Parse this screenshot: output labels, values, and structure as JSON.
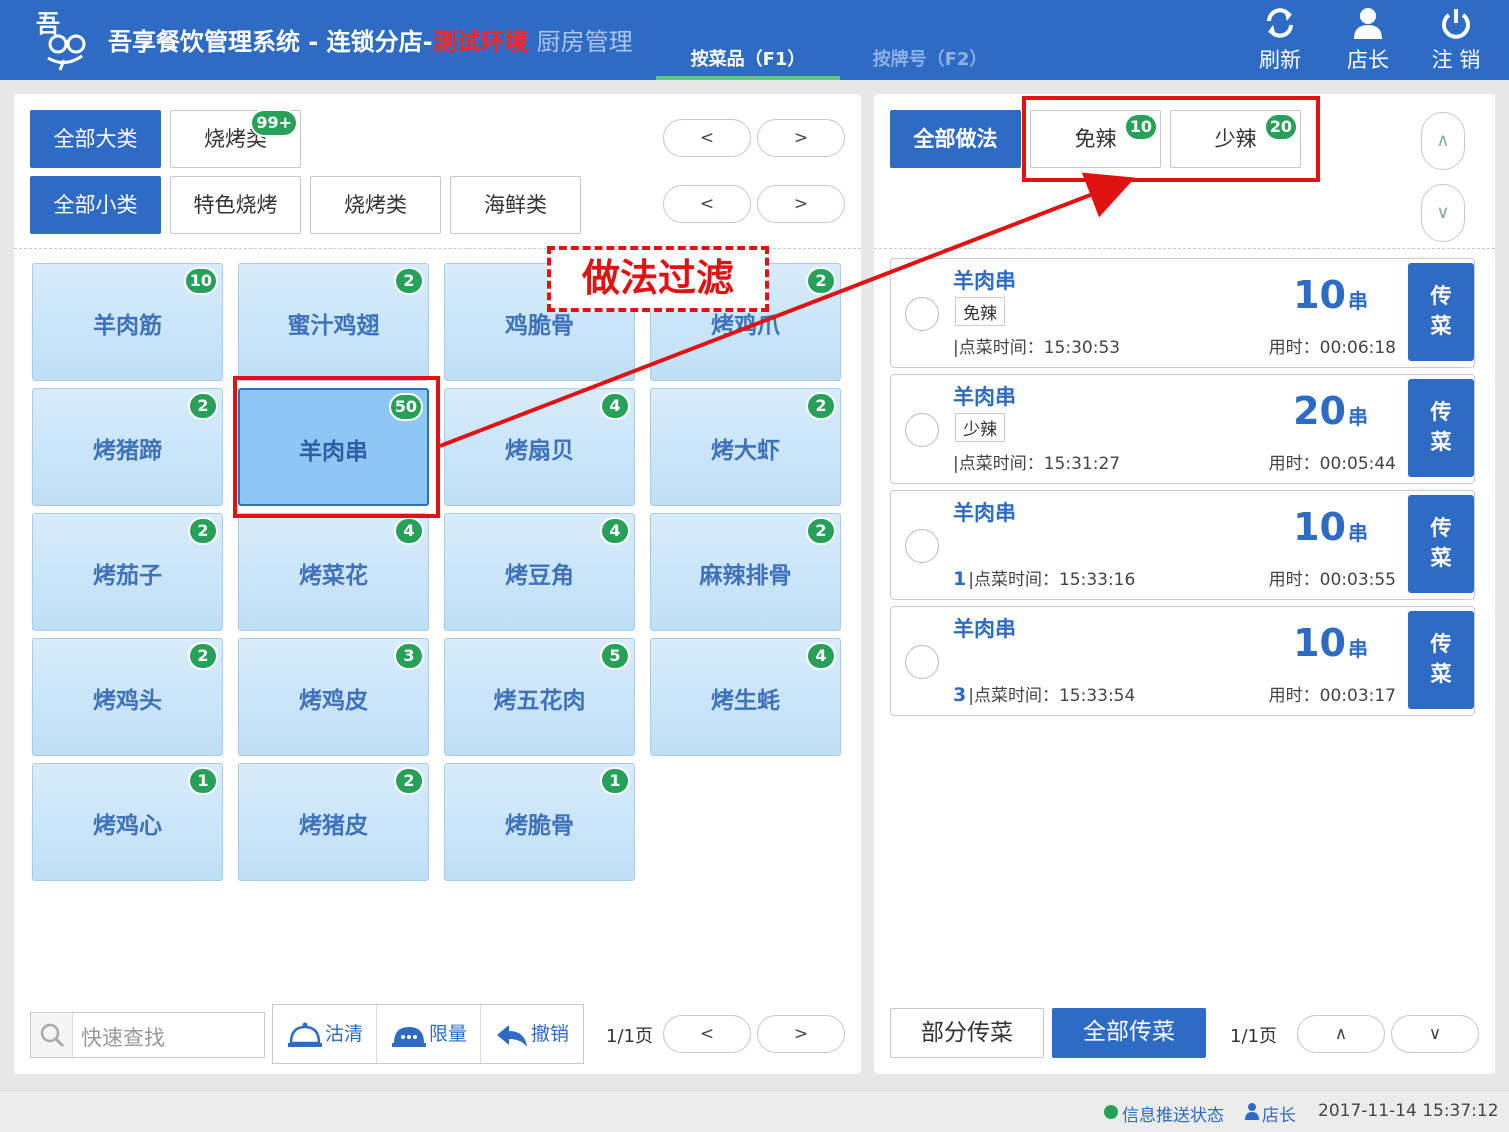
{
  "header": {
    "title_main": "吾享餐饮管理系统 - 连锁分店-",
    "title_env": "测试环境",
    "title_module": "厨房管理",
    "tabs": [
      {
        "label": "按菜品（F1）"
      },
      {
        "label": "按牌号（F2）"
      }
    ],
    "actions": {
      "refresh": "刷新",
      "manager": "店长",
      "logout": "注 销"
    },
    "colors": {
      "header": "#2e6bc4",
      "env": "#ff2424",
      "badge": "#27a05a"
    }
  },
  "left": {
    "big_categories": [
      {
        "label": "全部大类"
      },
      {
        "label": "烧烤类",
        "badge": "99+"
      }
    ],
    "small_categories": [
      {
        "label": "全部小类"
      },
      {
        "label": "特色烧烤"
      },
      {
        "label": "烧烤类"
      },
      {
        "label": "海鲜类"
      }
    ],
    "nav": {
      "prev": "<",
      "next": ">"
    },
    "dishes": [
      {
        "name": "羊肉筋",
        "count": "10"
      },
      {
        "name": "蜜汁鸡翅",
        "count": "2"
      },
      {
        "name": "鸡脆骨",
        "count": ""
      },
      {
        "name": "烤鸡爪",
        "count": "2"
      },
      {
        "name": "烤猪蹄",
        "count": "2"
      },
      {
        "name": "羊肉串",
        "count": "50"
      },
      {
        "name": "烤扇贝",
        "count": "4"
      },
      {
        "name": "烤大虾",
        "count": "2"
      },
      {
        "name": "烤茄子",
        "count": "2"
      },
      {
        "name": "烤菜花",
        "count": "4"
      },
      {
        "name": "烤豆角",
        "count": "4"
      },
      {
        "name": "麻辣排骨",
        "count": "2"
      },
      {
        "name": "烤鸡头",
        "count": "2"
      },
      {
        "name": "烤鸡皮",
        "count": "3"
      },
      {
        "name": "烤五花肉",
        "count": "5"
      },
      {
        "name": "烤生蚝",
        "count": "4"
      },
      {
        "name": "烤鸡心",
        "count": "1"
      },
      {
        "name": "烤猪皮",
        "count": "2"
      },
      {
        "name": "烤脆骨",
        "count": "1"
      }
    ],
    "search_placeholder": "快速查找",
    "tools": {
      "clear": "沽清",
      "limit": "限量",
      "undo": "撤销"
    },
    "page": "1/1页"
  },
  "right": {
    "methods": [
      {
        "label": "全部做法"
      },
      {
        "label": "免辣",
        "badge": "10"
      },
      {
        "label": "少辣",
        "badge": "20"
      }
    ],
    "scroll": {
      "up": "∧",
      "down": "∨"
    },
    "orders": [
      {
        "name": "羊肉串",
        "tag": "免辣",
        "prefix": "",
        "time_label": "|点菜时间：15:30:53",
        "qty": "10",
        "unit": "串",
        "used": "用时：00:06:18",
        "serve": "传 菜"
      },
      {
        "name": "羊肉串",
        "tag": "少辣",
        "prefix": "",
        "time_label": "|点菜时间：15:31:27",
        "qty": "20",
        "unit": "串",
        "used": "用时：00:05:44",
        "serve": "传 菜"
      },
      {
        "name": "羊肉串",
        "tag": "",
        "prefix": "1",
        "time_label": "|点菜时间：15:33:16",
        "qty": "10",
        "unit": "串",
        "used": "用时：00:03:55",
        "serve": "传 菜"
      },
      {
        "name": "羊肉串",
        "tag": "",
        "prefix": "3",
        "time_label": "|点菜时间：15:33:54",
        "qty": "10",
        "unit": "串",
        "used": "用时：00:03:17",
        "serve": "传 菜"
      }
    ],
    "partial_serve": "部分传菜",
    "all_serve": "全部传菜",
    "page": "1/1页"
  },
  "annotation": {
    "label": "做法过滤",
    "color": "#e01212"
  },
  "status": {
    "push": "信息推送状态",
    "user": "店长",
    "datetime": "2017-11-14 15:37:12"
  }
}
